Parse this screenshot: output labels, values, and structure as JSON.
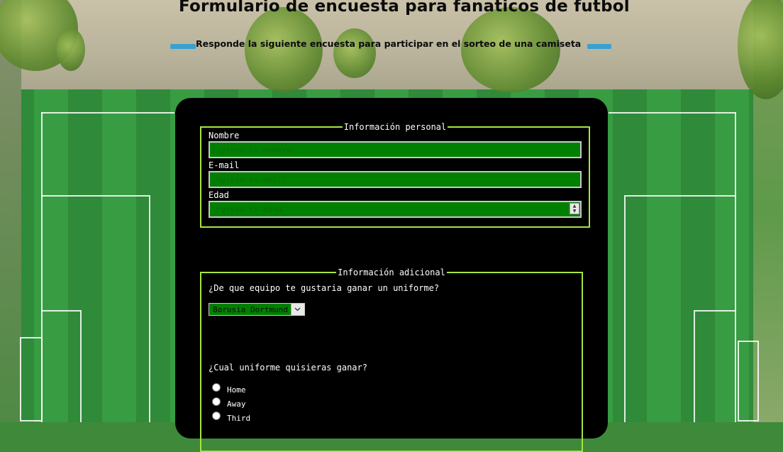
{
  "header": {
    "title": "Formulario de encuesta para fanaticos de futbol",
    "subtitle": "Responde la siguiente encuesta para participar en el sorteo de una camiseta"
  },
  "personal": {
    "legend": "Información personal",
    "name": {
      "label": "Nombre",
      "placeholder": "Ingresa tu nombre"
    },
    "email": {
      "label": "E-mail",
      "placeholder": "Ingresa tu email"
    },
    "age": {
      "label": "Edad",
      "placeholder": "Ingresa tu edad"
    }
  },
  "additional": {
    "legend": "Información adicional",
    "team_question": "¿De que equipo te gustaria ganar un uniforme?",
    "team_selected": "Borusia Dortmund",
    "uniform_question": "¿Cual uniforme quisieras ganar?",
    "uniform_options": [
      "Home",
      "Away",
      "Third"
    ]
  },
  "colors": {
    "accent_border": "#a6e63f",
    "input_bg": "#008000",
    "panel_bg": "#000000"
  }
}
